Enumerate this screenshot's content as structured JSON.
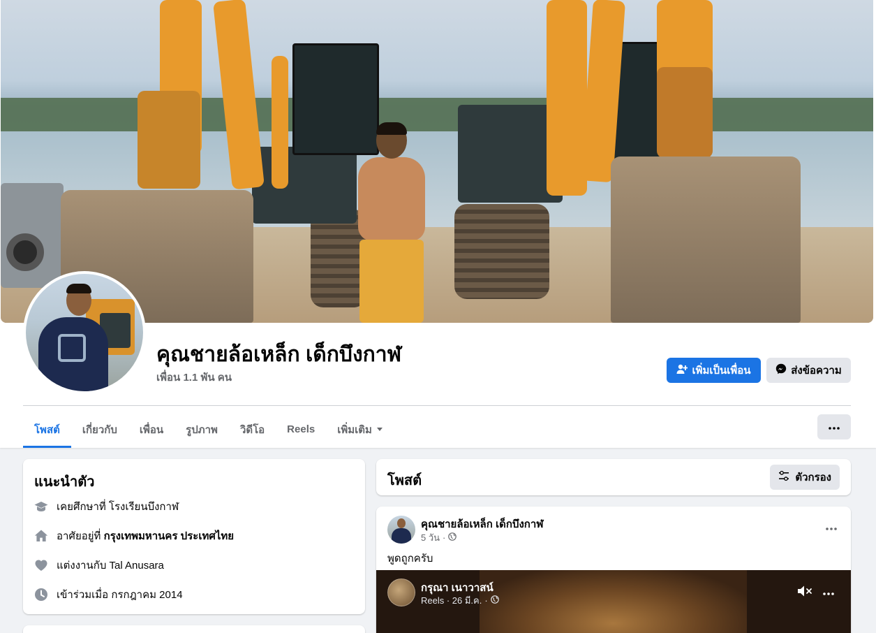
{
  "profile": {
    "name": "คุณชายล้อเหล็ก เด็กบึงกาฬ",
    "friends_count": "เพื่อน 1.1 พัน คน"
  },
  "actions": {
    "add_friend": "เพิ่มเป็นเพื่อน",
    "message": "ส่งข้อความ"
  },
  "tabs": [
    {
      "label": "โพสต์",
      "active": true
    },
    {
      "label": "เกี่ยวกับ",
      "active": false
    },
    {
      "label": "เพื่อน",
      "active": false
    },
    {
      "label": "รูปภาพ",
      "active": false
    },
    {
      "label": "วิดีโอ",
      "active": false
    },
    {
      "label": "Reels",
      "active": false
    },
    {
      "label": "เพิ่มเติม",
      "active": false
    }
  ],
  "intro": {
    "title": "แนะนำตัว",
    "items": [
      {
        "icon": "graduation-cap-icon",
        "prefix": "เคยศึกษาที่ ",
        "value": "โรงเรียนบึงกาฬ",
        "bold": false
      },
      {
        "icon": "home-icon",
        "prefix": "อาศัยอยู่ที่ ",
        "value": "กรุงเทพมหานคร ประเทศไทย",
        "bold": true
      },
      {
        "icon": "heart-icon",
        "prefix": "แต่งงานกับ ",
        "value": "Tal Anusara",
        "bold": false
      },
      {
        "icon": "clock-icon",
        "prefix": "เข้าร่วมเมื่อ ",
        "value": "กรกฎาคม 2014",
        "bold": false
      }
    ]
  },
  "posts": {
    "title": "โพสต์",
    "filter_label": "ตัวกรอง"
  },
  "post": {
    "author": "คุณชายล้อเหล็ก เด็กบึงกาฬ",
    "time": "5 วัน",
    "text": "พูดถูกครับ",
    "shared": {
      "author": "กรุณา เนาวาสน์",
      "meta": "Reels · 26 มี.ค."
    }
  },
  "colors": {
    "accent": "#1b74e4",
    "page_bg": "#f0f2f5",
    "secondary_text": "#65676b",
    "button_gray": "#e4e6eb"
  }
}
